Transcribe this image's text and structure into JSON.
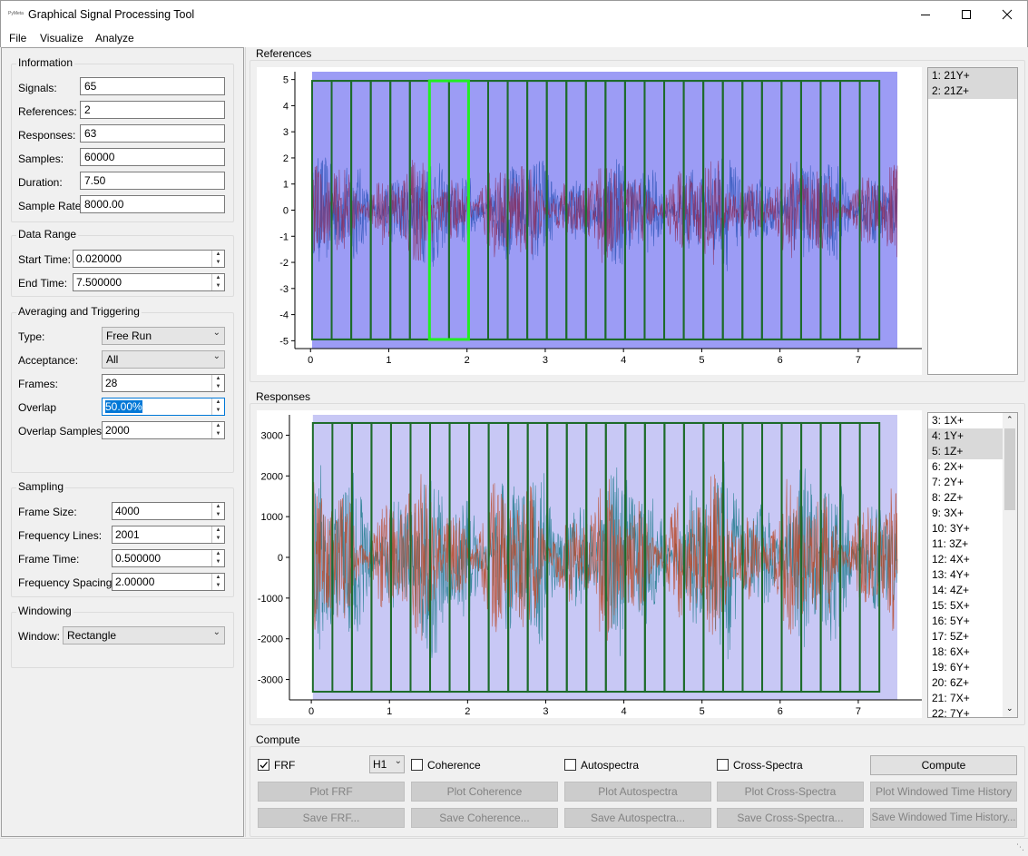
{
  "app": {
    "icon_text": "PyMeta",
    "title": "Graphical Signal Processing Tool"
  },
  "window_controls": [
    "minimize",
    "maximize",
    "close"
  ],
  "menu": [
    "File",
    "Visualize",
    "Analyze"
  ],
  "info": {
    "title": "Information",
    "rows": [
      {
        "label": "Signals:",
        "value": "65"
      },
      {
        "label": "References:",
        "value": "2"
      },
      {
        "label": "Responses:",
        "value": "63"
      },
      {
        "label": "Samples:",
        "value": "60000"
      },
      {
        "label": "Duration:",
        "value": "7.50"
      },
      {
        "label": "Sample Rate",
        "value": "8000.00"
      }
    ]
  },
  "data_range": {
    "title": "Data Range",
    "start_label": "Start Time:",
    "start_value": "0.020000",
    "end_label": "End Time:",
    "end_value": "7.500000"
  },
  "averaging": {
    "title": "Averaging and Triggering",
    "type_label": "Type:",
    "type_value": "Free Run",
    "acceptance_label": "Acceptance:",
    "acceptance_value": "All",
    "frames_label": "Frames:",
    "frames_value": "28",
    "overlap_label": "Overlap",
    "overlap_value": "50.00%",
    "overlap_samples_label": "Overlap Samples:",
    "overlap_samples_value": "2000"
  },
  "sampling": {
    "title": "Sampling",
    "frame_size_label": "Frame Size:",
    "frame_size_value": "4000",
    "freq_lines_label": "Frequency Lines:",
    "freq_lines_value": "2001",
    "frame_time_label": "Frame Time:",
    "frame_time_value": "0.500000",
    "freq_spacing_label": "Frequency Spacing:",
    "freq_spacing_value": "2.00000"
  },
  "windowing": {
    "title": "Windowing",
    "window_label": "Window:",
    "window_value": "Rectangle"
  },
  "references": {
    "title": "References",
    "yticks": [
      "5",
      "4",
      "3",
      "2",
      "1",
      "0",
      "-1",
      "-2",
      "-3",
      "-4",
      "-5"
    ],
    "xticks": [
      "0",
      "1",
      "2",
      "3",
      "4",
      "5",
      "6",
      "7"
    ],
    "items": [
      "1: 21Y+",
      "2: 21Z+"
    ]
  },
  "responses": {
    "title": "Responses",
    "yticks": [
      "3000",
      "2000",
      "1000",
      "0",
      "-1000",
      "-2000",
      "-3000"
    ],
    "xticks": [
      "0",
      "1",
      "2",
      "3",
      "4",
      "5",
      "6",
      "7"
    ],
    "items": [
      "3: 1X+",
      "4: 1Y+",
      "5: 1Z+",
      "6: 2X+",
      "7: 2Y+",
      "8: 2Z+",
      "9: 3X+",
      "10: 3Y+",
      "11: 3Z+",
      "12: 4X+",
      "13: 4Y+",
      "14: 4Z+",
      "15: 5X+",
      "16: 5Y+",
      "17: 5Z+",
      "18: 6X+",
      "19: 6Y+",
      "20: 6Z+",
      "21: 7X+",
      "22: 7Y+"
    ]
  },
  "compute": {
    "title": "Compute",
    "frf_label": "FRF",
    "frf_checked": true,
    "estimator": "H1",
    "coherence_label": "Coherence",
    "autospectra_label": "Autospectra",
    "cross_label": "Cross-Spectra",
    "compute_button": "Compute",
    "plot_buttons": [
      "Plot FRF",
      "Plot Coherence",
      "Plot Autospectra",
      "Plot Cross-Spectra",
      "Plot Windowed Time History"
    ],
    "save_buttons": [
      "Save FRF...",
      "Save Coherence...",
      "Save Autospectra...",
      "Save Cross-Spectra...",
      "Save Windowed Time History..."
    ]
  },
  "colors": {
    "ref_bg": "#9c9cf5",
    "resp_bg": "#c8c8f5",
    "frame": "#1d6b2a",
    "highlight": "#22ee22",
    "ref_signal_a": "#2f55b8",
    "ref_signal_b": "#8a3060",
    "resp_signal_a": "#1f7a8c",
    "resp_signal_b": "#b84a2a"
  },
  "chart_data": [
    {
      "type": "line",
      "title": "",
      "xlabel": "",
      "ylabel": "",
      "xlim": [
        0,
        7.5
      ],
      "ylim": [
        -5,
        5
      ],
      "series": [
        {
          "name": "1: 21Y+",
          "amplitude": 2.4
        },
        {
          "name": "2: 21Z+",
          "amplitude": 2.2
        }
      ],
      "frames": 28,
      "frame_length": 0.5,
      "overlap": 0.5,
      "start_time": 0.02,
      "end_time": 7.5,
      "highlighted_frame": 6
    },
    {
      "type": "line",
      "title": "",
      "xlabel": "",
      "ylabel": "",
      "xlim": [
        0,
        7.5
      ],
      "ylim": [
        -3300,
        3300
      ],
      "series": [
        {
          "name": "3: 1X+",
          "amplitude": 2600
        },
        {
          "name": "4: 1Y+",
          "amplitude": 2200
        }
      ],
      "frames": 28,
      "frame_length": 0.5,
      "overlap": 0.5,
      "start_time": 0.02,
      "end_time": 7.5
    }
  ]
}
